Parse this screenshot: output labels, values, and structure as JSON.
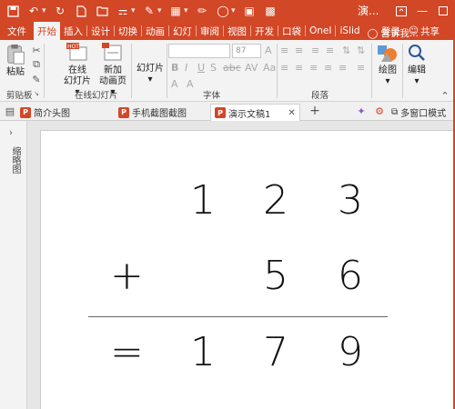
{
  "window": {
    "title": "演..."
  },
  "quick_access": [
    "save-icon",
    "undo-icon",
    "redo-icon",
    "new-icon",
    "open-icon",
    "format-icon",
    "paint-icon",
    "table-icon",
    "brush-icon",
    "shapes-icon",
    "grid-icon",
    "slideshow-icon"
  ],
  "menu": {
    "tabs": [
      "文件",
      "开始",
      "插入",
      "设计",
      "切换",
      "动画",
      "幻灯",
      "审阅",
      "视图",
      "开发",
      "口袋",
      "OneI",
      "iSlid"
    ],
    "active_tab": "开始",
    "tell_me": "告诉我...",
    "login": "登录",
    "share": "共享"
  },
  "ribbon": {
    "clipboard": {
      "paste": "粘贴",
      "label": "剪贴板"
    },
    "slides": {
      "online_slide": "在线\n幻灯片",
      "new_anim": "新加\n动画页",
      "slide_btn": "幻灯片",
      "label": "在线幻灯片"
    },
    "font": {
      "size": "87",
      "label": "字体"
    },
    "paragraph": {
      "label": "段落"
    },
    "draw": {
      "label": "绘图"
    },
    "edit": {
      "label": "编辑"
    }
  },
  "doc_tabs": {
    "tabs": [
      "简介头图",
      "手机截图截图",
      "演示文稿1"
    ],
    "active": "演示文稿1",
    "multi_window": "多窗口模式"
  },
  "left_pane": {
    "label": "缩略图"
  },
  "slide": {
    "row1": [
      "1",
      "2",
      "3"
    ],
    "row2_op": "+",
    "row2": [
      "5",
      "6"
    ],
    "row3_op": "=",
    "row3": [
      "1",
      "7",
      "9"
    ]
  },
  "colors": {
    "accent": "#d24726"
  }
}
